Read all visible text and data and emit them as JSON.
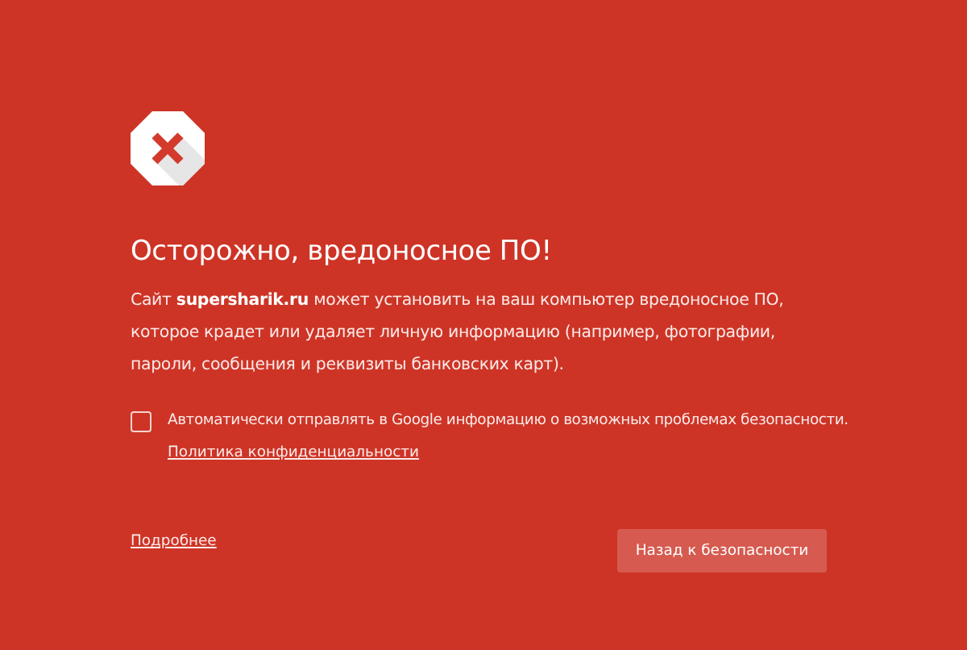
{
  "heading": "Осторожно, вредоносное ПО!",
  "message": "Сайт **supersharik.ru** может установить на ваш компьютер вредоносное ПО, которое крадет или удаляет личную информацию (например, фотографии, пароли, сообщения и реквизиты банковских карт).",
  "report": {
    "label": "Автоматически отправлять в Google информацию о возможных проблемах безопасности.",
    "checked": false,
    "link": "Политика конфиденциальности"
  },
  "details_link": "Подробнее",
  "back_button": "Назад к безопасности"
}
